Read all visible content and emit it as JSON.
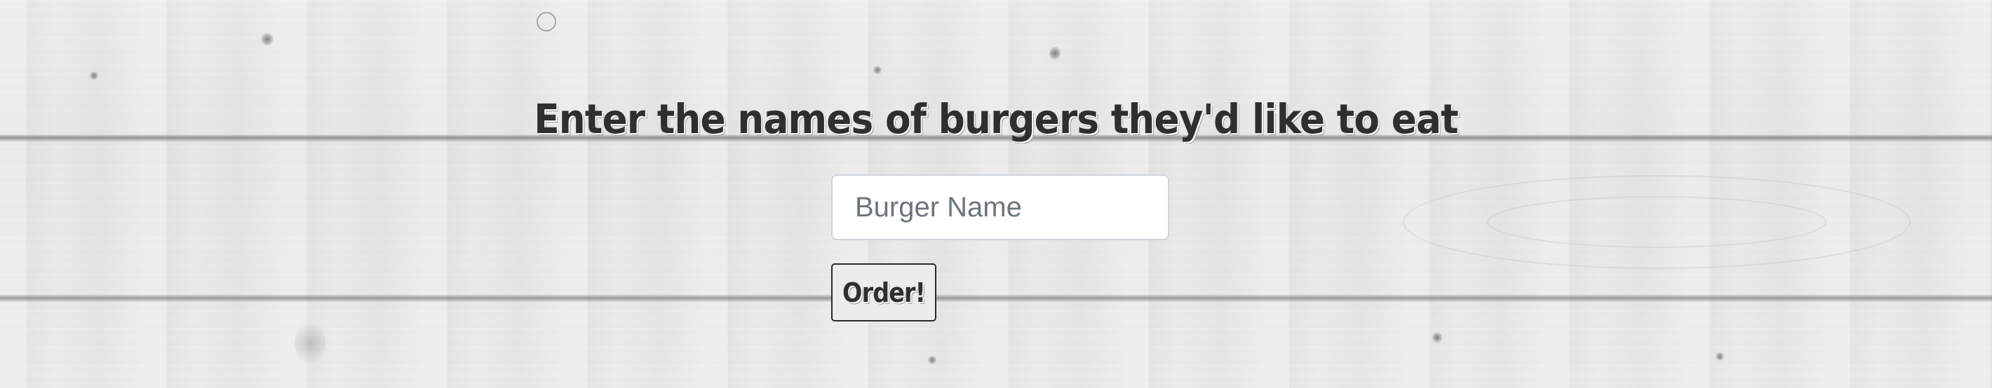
{
  "page": {
    "heading": "Enter the names of burgers they'd like to eat"
  },
  "form": {
    "burger_input": {
      "value": "",
      "placeholder": "Burger Name"
    },
    "submit_label": "Order!"
  },
  "colors": {
    "heading_text": "#2f2f2f",
    "input_placeholder": "#6c757d",
    "input_border": "#cfd4da",
    "button_border": "#2a2a2a",
    "background_wood": "#e6e6e6"
  }
}
